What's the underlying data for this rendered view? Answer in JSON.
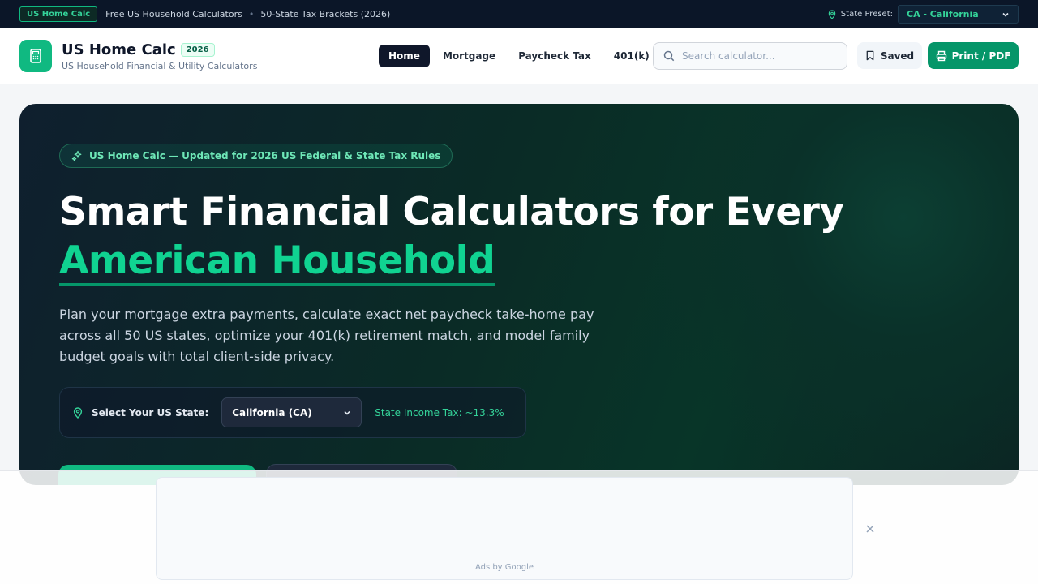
{
  "topbar": {
    "brand_chip": "US Home Calc",
    "text1": "Free US Household Calculators",
    "separator": "•",
    "text2": "50-State Tax Brackets (2026)",
    "preset_label": "State Preset:",
    "preset_value": "CA - California"
  },
  "header": {
    "title": "US Home Calc",
    "year_badge": "2026",
    "subtitle": "US Household Financial & Utility Calculators",
    "nav": [
      "Home",
      "Mortgage",
      "Paycheck Tax",
      "401(k)"
    ],
    "active_nav": "Home",
    "search_placeholder": "Search calculator...",
    "saved_label": "Saved",
    "print_label": "Print / PDF"
  },
  "hero": {
    "pill": "US Home Calc — Updated for 2026 US Federal & State Tax Rules",
    "title_line1": "Smart Financial Calculators for Every",
    "title_line2": "American Household",
    "description": "Plan your mortgage extra payments, calculate exact net paycheck take-home pay across all 50 US states, optimize your 401(k) retirement match, and model family budget goals with total client-side privacy.",
    "state_label": "Select Your US State:",
    "state_value": "California (CA)",
    "state_tax": "State Income Tax: ~13.3%"
  },
  "ad": {
    "label": "Ads by Google"
  },
  "colors": {
    "accent": "#10b981",
    "dark": "#0f172a",
    "hero_bg": "#0a2b26",
    "highlight_text": "#10d391"
  },
  "icons": {
    "location": "map-pin-icon",
    "calculator": "calculator-icon",
    "search": "search-icon",
    "bookmark": "bookmark-icon",
    "printer": "printer-icon",
    "sparkles": "sparkles-icon",
    "chevron": "chevron-down-icon",
    "close": "close-icon"
  }
}
